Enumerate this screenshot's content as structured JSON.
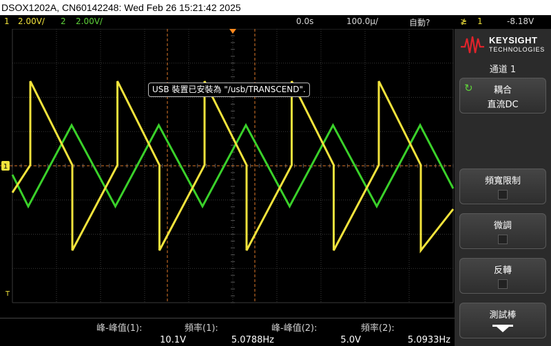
{
  "title": "DSOX1202A, CN60142248: Wed Feb 26 15:21:42 2025",
  "status": {
    "ch1_num": "1",
    "ch1_scale": "2.00V/",
    "ch2_num": "2",
    "ch2_scale": "2.00V/",
    "time_delay": "0.0s",
    "time_scale": "100.0µ/",
    "trigger_mode": "自動?",
    "trigger_channel": "1",
    "trigger_level": "-8.18V"
  },
  "colors": {
    "channel1": "#f2e33c",
    "channel2": "#5fd33a",
    "cursor": "#e07a2a",
    "grid": "#3a3a3a"
  },
  "toast": "USB 裝置已安裝為 \"/usb/TRANSCEND\".",
  "markers": {
    "ground_marker": "1",
    "trigger_marker": "T"
  },
  "sidebar": {
    "brand": "KEYSIGHT",
    "brand_sub": "TECHNOLOGIES",
    "menu_title": "通道 1",
    "coupling_label": "耦合",
    "coupling_value": "直流DC",
    "bw_limit_label": "頻寬限制",
    "vernier_label": "微調",
    "invert_label": "反轉",
    "probe_label": "測試棒"
  },
  "measurements": [
    {
      "label": "峰-峰值(1):",
      "value": "10.1V"
    },
    {
      "label": "頻率(1):",
      "value": "5.0788Hz"
    },
    {
      "label": "峰-峰值(2):",
      "value": "5.0V"
    },
    {
      "label": "頻率(2):",
      "value": "5.0933Hz"
    }
  ]
}
